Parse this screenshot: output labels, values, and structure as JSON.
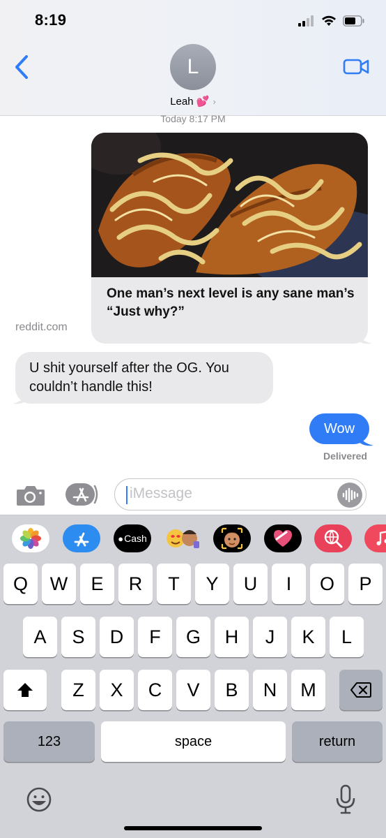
{
  "status_bar": {
    "time": "8:19"
  },
  "header": {
    "avatar_initial": "L",
    "contact_name": "Leah 💕",
    "chevron": "›",
    "back_icon": "chevron-left-icon",
    "video_icon": "video-camera-icon"
  },
  "conversation": {
    "timestamp": "Today 8:17 PM",
    "link_preview": {
      "title": "One man’s next level is any sane man’s “Just why?”",
      "domain": "reddit.com"
    },
    "messages": [
      {
        "direction": "incoming",
        "text": "U shit yourself after the OG. You couldn’t handle this!"
      },
      {
        "direction": "outgoing",
        "text": "Wow"
      }
    ],
    "delivery_status": "Delivered"
  },
  "compose": {
    "placeholder": "iMessage"
  },
  "apps_row": {
    "cash_label": "Cash"
  },
  "keyboard": {
    "row1": [
      "Q",
      "W",
      "E",
      "R",
      "T",
      "Y",
      "U",
      "I",
      "O",
      "P"
    ],
    "row2": [
      "A",
      "S",
      "D",
      "F",
      "G",
      "H",
      "J",
      "K",
      "L"
    ],
    "row3": [
      "Z",
      "X",
      "C",
      "V",
      "B",
      "N",
      "M"
    ],
    "numbers_label": "123",
    "space_label": "space",
    "return_label": "return"
  },
  "colors": {
    "accent": "#2f7cf6",
    "incoming_bubble": "#e9e9eb",
    "keyboard_bg": "#d1d3d9"
  }
}
